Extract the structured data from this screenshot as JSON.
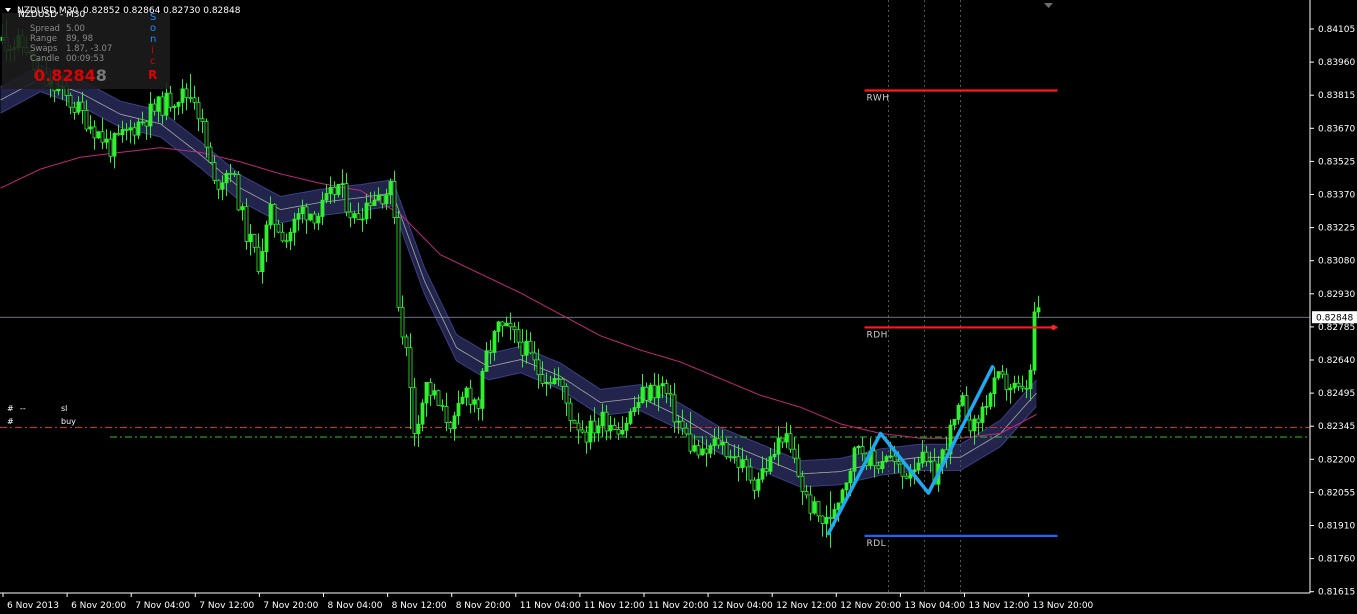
{
  "header": {
    "symbol": "NZDUSD,M30",
    "ohlc": "0.82852 0.82864 0.82730 0.82848"
  },
  "info_panel": {
    "partial_title": "NZDUSD - M30",
    "rows": [
      {
        "label": "Spread",
        "value": "5.00"
      },
      {
        "label": "Range",
        "value": "89, 98"
      },
      {
        "label": "Swaps",
        "value": "1.87, -3.07"
      },
      {
        "label": "Candle",
        "value": "00:09:53"
      }
    ],
    "big_price_red": "0.8284",
    "big_price_grey": "8",
    "sonic_letters": [
      "S",
      "o",
      "n",
      "i",
      "c"
    ],
    "sonic_last": "R",
    "colors": {
      "red": "#e00000",
      "grey": "#777777",
      "blue": "#1e8cff"
    }
  },
  "trade_tags": [
    {
      "prefix": "#",
      "dash": "--",
      "label": "sl",
      "color": "#e53030"
    },
    {
      "prefix": "#",
      "dash": "",
      "label": "buy",
      "color": "#33cc33"
    }
  ],
  "current_price_label": "0.82848",
  "chart_data": {
    "type": "candlestick",
    "timeframe": "M30",
    "ylim": [
      0.8169,
      0.8418
    ],
    "y_ticks": [
      "0.84105",
      "0.83960",
      "0.83815",
      "0.83670",
      "0.83525",
      "0.83370",
      "0.83225",
      "0.83080",
      "0.82930",
      "0.82785",
      "0.82640",
      "0.82495",
      "0.82345",
      "0.82200",
      "0.82055",
      "0.81910",
      "0.81760",
      "0.81615"
    ],
    "y_tick_values": [
      0.84105,
      0.8396,
      0.83815,
      0.8367,
      0.83525,
      0.8337,
      0.83225,
      0.8308,
      0.8293,
      0.82785,
      0.8264,
      0.82495,
      0.82345,
      0.822,
      0.82055,
      0.8191,
      0.8176,
      0.81615
    ],
    "x_ticks": [
      "6 Nov 2013",
      "6 Nov 20:00",
      "7 Nov 04:00",
      "7 Nov 12:00",
      "7 Nov 20:00",
      "8 Nov 04:00",
      "8 Nov 12:00",
      "8 Nov 20:00",
      "11 Nov 04:00",
      "11 Nov 12:00",
      "11 Nov 20:00",
      "12 Nov 04:00",
      "12 Nov 12:00",
      "12 Nov 20:00",
      "13 Nov 04:00",
      "13 Nov 12:00",
      "13 Nov 20:00"
    ],
    "x_tick_bars": [
      0,
      16,
      32,
      48,
      64,
      80,
      96,
      112,
      128,
      144,
      160,
      176,
      192,
      208,
      224,
      240,
      256
    ],
    "close_path": [
      [
        0,
        0.8401
      ],
      [
        6,
        0.8398
      ],
      [
        9,
        0.8385
      ],
      [
        14,
        0.838
      ],
      [
        20,
        0.837
      ],
      [
        27,
        0.8356
      ],
      [
        33,
        0.8365
      ],
      [
        38,
        0.8372
      ],
      [
        44,
        0.8378
      ],
      [
        48,
        0.8378
      ],
      [
        50,
        0.8364
      ],
      [
        53,
        0.834
      ],
      [
        57,
        0.8348
      ],
      [
        61,
        0.832
      ],
      [
        64,
        0.8308
      ],
      [
        67,
        0.8328
      ],
      [
        71,
        0.8318
      ],
      [
        75,
        0.833
      ],
      [
        79,
        0.8328
      ],
      [
        84,
        0.834
      ],
      [
        88,
        0.8326
      ],
      [
        92,
        0.8335
      ],
      [
        97,
        0.8338
      ],
      [
        98,
        0.833
      ],
      [
        99,
        0.829
      ],
      [
        101,
        0.827
      ],
      [
        103,
        0.8238
      ],
      [
        106,
        0.8256
      ],
      [
        108,
        0.8251
      ],
      [
        110,
        0.8244
      ],
      [
        113,
        0.824
      ],
      [
        116,
        0.8254
      ],
      [
        119,
        0.8248
      ],
      [
        121,
        0.8268
      ],
      [
        124,
        0.828
      ],
      [
        127,
        0.8278
      ],
      [
        130,
        0.8273
      ],
      [
        134,
        0.8262
      ],
      [
        139,
        0.8258
      ],
      [
        142,
        0.8244
      ],
      [
        146,
        0.8236
      ],
      [
        150,
        0.8242
      ],
      [
        155,
        0.8239
      ],
      [
        160,
        0.8252
      ],
      [
        165,
        0.8256
      ],
      [
        168,
        0.8244
      ],
      [
        172,
        0.8231
      ],
      [
        175,
        0.8226
      ],
      [
        179,
        0.8233
      ],
      [
        184,
        0.8224
      ],
      [
        188,
        0.8216
      ],
      [
        192,
        0.8224
      ],
      [
        195,
        0.8236
      ],
      [
        198,
        0.8224
      ],
      [
        201,
        0.8208
      ],
      [
        204,
        0.8201
      ],
      [
        206,
        0.8198
      ],
      [
        208,
        0.8206
      ],
      [
        211,
        0.8218
      ],
      [
        214,
        0.8232
      ],
      [
        218,
        0.8222
      ],
      [
        221,
        0.8228
      ],
      [
        225,
        0.8218
      ],
      [
        229,
        0.8226
      ],
      [
        233,
        0.8218
      ],
      [
        237,
        0.8236
      ],
      [
        240,
        0.8248
      ],
      [
        243,
        0.8238
      ],
      [
        246,
        0.825
      ],
      [
        249,
        0.8258
      ],
      [
        252,
        0.8256
      ],
      [
        255,
        0.8252
      ],
      [
        257,
        0.826
      ],
      [
        258,
        0.8287
      ],
      [
        259,
        0.82848
      ]
    ],
    "indicators": {
      "ma_pink": [
        [
          0,
          0.8339
        ],
        [
          10,
          0.8347
        ],
        [
          20,
          0.8352
        ],
        [
          30,
          0.8354
        ],
        [
          40,
          0.8356
        ],
        [
          50,
          0.8354
        ],
        [
          60,
          0.835
        ],
        [
          70,
          0.8345
        ],
        [
          80,
          0.8341
        ],
        [
          90,
          0.8338
        ],
        [
          100,
          0.8328
        ],
        [
          110,
          0.8311
        ],
        [
          120,
          0.8303
        ],
        [
          130,
          0.8295
        ],
        [
          140,
          0.8286
        ],
        [
          150,
          0.8277
        ],
        [
          160,
          0.8271
        ],
        [
          170,
          0.8266
        ],
        [
          180,
          0.8259
        ],
        [
          190,
          0.8252
        ],
        [
          200,
          0.8247
        ],
        [
          210,
          0.824
        ],
        [
          220,
          0.8236
        ],
        [
          230,
          0.8234
        ],
        [
          240,
          0.8234
        ],
        [
          250,
          0.8236
        ],
        [
          259,
          0.8244
        ]
      ],
      "channel_mid": [
        [
          0,
          0.8376
        ],
        [
          10,
          0.8385
        ],
        [
          20,
          0.8379
        ],
        [
          30,
          0.837
        ],
        [
          40,
          0.8366
        ],
        [
          50,
          0.8353
        ],
        [
          60,
          0.8339
        ],
        [
          70,
          0.833
        ],
        [
          80,
          0.8333
        ],
        [
          90,
          0.8335
        ],
        [
          98,
          0.8337
        ],
        [
          106,
          0.83
        ],
        [
          114,
          0.8272
        ],
        [
          122,
          0.8264
        ],
        [
          130,
          0.8267
        ],
        [
          140,
          0.826
        ],
        [
          150,
          0.8249
        ],
        [
          160,
          0.8251
        ],
        [
          170,
          0.8243
        ],
        [
          180,
          0.8233
        ],
        [
          190,
          0.8226
        ],
        [
          200,
          0.8219
        ],
        [
          210,
          0.822
        ],
        [
          220,
          0.8224
        ],
        [
          230,
          0.8226
        ],
        [
          240,
          0.8226
        ],
        [
          250,
          0.8236
        ],
        [
          259,
          0.8253
        ]
      ],
      "channel_half_width": 0.00055
    },
    "levels": [
      {
        "name": "RWH",
        "price": 0.838,
        "color": "#ff1a1a",
        "bar_from": 208,
        "bar_to": 254
      },
      {
        "name": "RDH",
        "price": 0.82805,
        "color": "#ff1a1a",
        "bar_from": 208,
        "bar_to": 254
      },
      {
        "name": "RDL",
        "price": 0.8193,
        "color": "#1e64ff",
        "bar_from": 208,
        "bar_to": 254
      }
    ],
    "sl_line": 0.82385,
    "buy_line": 0.82345,
    "current_price": 0.82848,
    "zigzag": [
      [
        199,
        0.8194
      ],
      [
        212,
        0.8236
      ],
      [
        224,
        0.8211
      ],
      [
        240,
        0.8264
      ]
    ],
    "vlines_bars": [
      222,
      231,
      240
    ],
    "price_dot": {
      "bar": 261,
      "price": 0.82805
    }
  }
}
